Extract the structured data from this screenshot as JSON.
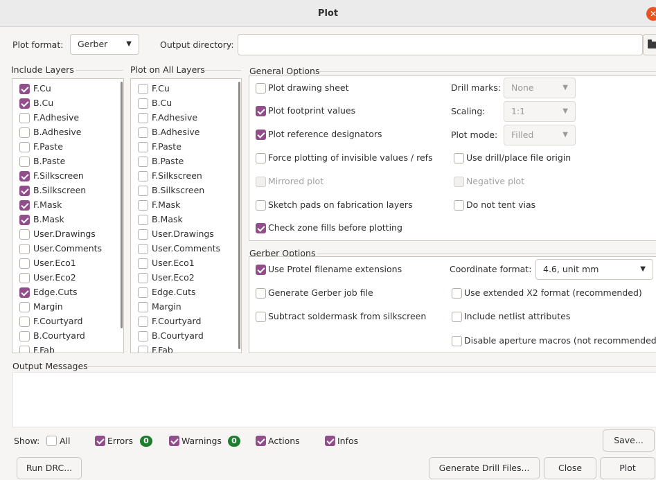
{
  "window": {
    "title": "Plot"
  },
  "top": {
    "plot_format_label": "Plot format:",
    "plot_format_value": "Gerber",
    "output_dir_label": "Output directory:",
    "output_dir_value": ""
  },
  "include_layers": {
    "title": "Include Layers",
    "items": [
      {
        "label": "F.Cu",
        "checked": true
      },
      {
        "label": "B.Cu",
        "checked": true
      },
      {
        "label": "F.Adhesive",
        "checked": false
      },
      {
        "label": "B.Adhesive",
        "checked": false
      },
      {
        "label": "F.Paste",
        "checked": false
      },
      {
        "label": "B.Paste",
        "checked": false
      },
      {
        "label": "F.Silkscreen",
        "checked": true
      },
      {
        "label": "B.Silkscreen",
        "checked": true
      },
      {
        "label": "F.Mask",
        "checked": true
      },
      {
        "label": "B.Mask",
        "checked": true
      },
      {
        "label": "User.Drawings",
        "checked": false
      },
      {
        "label": "User.Comments",
        "checked": false
      },
      {
        "label": "User.Eco1",
        "checked": false
      },
      {
        "label": "User.Eco2",
        "checked": false
      },
      {
        "label": "Edge.Cuts",
        "checked": true
      },
      {
        "label": "Margin",
        "checked": false
      },
      {
        "label": "F.Courtyard",
        "checked": false
      },
      {
        "label": "B.Courtyard",
        "checked": false
      },
      {
        "label": "F.Fab",
        "checked": false
      }
    ]
  },
  "plot_all_layers": {
    "title": "Plot on All Layers",
    "items": [
      {
        "label": "F.Cu",
        "checked": false
      },
      {
        "label": "B.Cu",
        "checked": false
      },
      {
        "label": "F.Adhesive",
        "checked": false
      },
      {
        "label": "B.Adhesive",
        "checked": false
      },
      {
        "label": "F.Paste",
        "checked": false
      },
      {
        "label": "B.Paste",
        "checked": false
      },
      {
        "label": "F.Silkscreen",
        "checked": false
      },
      {
        "label": "B.Silkscreen",
        "checked": false
      },
      {
        "label": "F.Mask",
        "checked": false
      },
      {
        "label": "B.Mask",
        "checked": false
      },
      {
        "label": "User.Drawings",
        "checked": false
      },
      {
        "label": "User.Comments",
        "checked": false
      },
      {
        "label": "User.Eco1",
        "checked": false
      },
      {
        "label": "User.Eco2",
        "checked": false
      },
      {
        "label": "Edge.Cuts",
        "checked": false
      },
      {
        "label": "Margin",
        "checked": false
      },
      {
        "label": "F.Courtyard",
        "checked": false
      },
      {
        "label": "B.Courtyard",
        "checked": false
      },
      {
        "label": "F.Fab",
        "checked": false
      }
    ]
  },
  "general_options": {
    "title": "General Options",
    "plot_drawing_sheet": {
      "label": "Plot drawing sheet",
      "checked": false
    },
    "plot_footprint_values": {
      "label": "Plot footprint values",
      "checked": true
    },
    "plot_reference_designators": {
      "label": "Plot reference designators",
      "checked": true
    },
    "force_invisible": {
      "label": "Force plotting of invisible values / refs",
      "checked": false
    },
    "mirrored_plot": {
      "label": "Mirrored plot",
      "checked": false,
      "disabled": true
    },
    "sketch_pads": {
      "label": "Sketch pads on fabrication layers",
      "checked": false
    },
    "check_zone_fills": {
      "label": "Check zone fills before plotting",
      "checked": true
    },
    "drill_marks_label": "Drill marks:",
    "drill_marks_value": "None",
    "scaling_label": "Scaling:",
    "scaling_value": "1:1",
    "plot_mode_label": "Plot mode:",
    "plot_mode_value": "Filled",
    "use_drill_origin": {
      "label": "Use drill/place file origin",
      "checked": false
    },
    "negative_plot": {
      "label": "Negative plot",
      "checked": false,
      "disabled": true
    },
    "do_not_tent_vias": {
      "label": "Do not tent vias",
      "checked": false
    }
  },
  "gerber_options": {
    "title": "Gerber Options",
    "protel_ext": {
      "label": "Use Protel filename extensions",
      "checked": true
    },
    "gerber_job": {
      "label": "Generate Gerber job file",
      "checked": false
    },
    "subtract_soldermask": {
      "label": "Subtract soldermask from silkscreen",
      "checked": false
    },
    "coord_format_label": "Coordinate format:",
    "coord_format_value": "4.6, unit mm",
    "extended_x2": {
      "label": "Use extended X2 format (recommended)",
      "checked": false
    },
    "netlist_attrs": {
      "label": "Include netlist attributes",
      "checked": false
    },
    "disable_aperture": {
      "label": "Disable aperture macros (not recommended)",
      "checked": false
    }
  },
  "output_messages": {
    "title": "Output Messages",
    "show_label": "Show:",
    "all": {
      "label": "All",
      "checked": false
    },
    "errors": {
      "label": "Errors",
      "checked": true,
      "count": "0"
    },
    "warnings": {
      "label": "Warnings",
      "checked": true,
      "count": "0"
    },
    "actions": {
      "label": "Actions",
      "checked": true
    },
    "infos": {
      "label": "Infos",
      "checked": true
    },
    "save_label": "Save..."
  },
  "buttons": {
    "run_drc": "Run DRC...",
    "generate_drill": "Generate Drill Files...",
    "close": "Close",
    "plot": "Plot"
  },
  "colors": {
    "accent": "#924d8b",
    "badge": "#1e7e2e",
    "close_button": "#e95420"
  },
  "icons": {
    "close": "close-icon",
    "folder": "folder-icon",
    "dropdown": "chevron-down-icon"
  }
}
